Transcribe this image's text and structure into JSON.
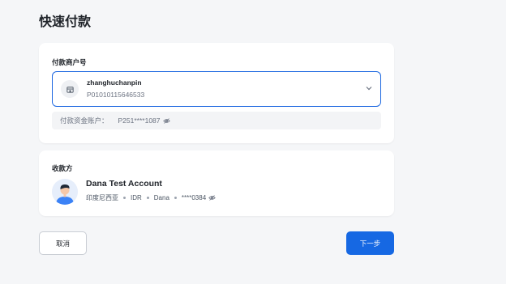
{
  "page": {
    "title": "快速付款"
  },
  "payer": {
    "label": "付款商户号",
    "merchant": {
      "name": "zhanghuchanpin",
      "id": "P01010115646533",
      "icon": "store-icon"
    },
    "fund_account": {
      "label": "付款资金账户：",
      "value": "P251****1087",
      "visibility_icon": "eye-off-icon"
    }
  },
  "payee": {
    "label": "收款方",
    "name": "Dana Test Account",
    "country": "印度尼西亚",
    "currency": "IDR",
    "channel": "Dana",
    "account_masked": "****0384",
    "visibility_icon": "eye-off-icon"
  },
  "actions": {
    "cancel_label": "取消",
    "next_label": "下一步"
  },
  "colors": {
    "primary": "#1668e3",
    "focus_border": "#1a66e0",
    "background": "#f5f6f8"
  }
}
